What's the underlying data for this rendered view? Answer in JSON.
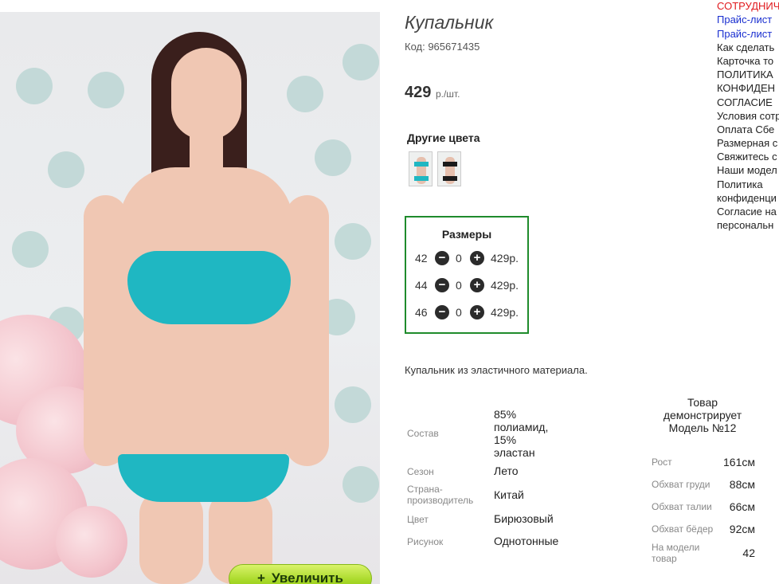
{
  "product": {
    "title": "Купальник",
    "code": "Код: 965671435",
    "price": "429",
    "price_unit": "р./шт.",
    "other_colors_title": "Другие цвета",
    "description": "Купальник из эластичного материала."
  },
  "photo": {
    "zoom_plus": "+",
    "zoom_label": "Увеличить"
  },
  "sizes": {
    "title": "Размеры",
    "rows": [
      {
        "size": "42",
        "qty": "0",
        "price": "429р."
      },
      {
        "size": "44",
        "qty": "0",
        "price": "429р."
      },
      {
        "size": "46",
        "qty": "0",
        "price": "429р."
      }
    ]
  },
  "specs": [
    {
      "label": "Состав",
      "value": "85% полиамид, 15% эластан"
    },
    {
      "label": "Сезон",
      "value": "Лето"
    },
    {
      "label": "Страна-производитель",
      "value": "Китай"
    },
    {
      "label": "Цвет",
      "value": "Бирюзовый"
    },
    {
      "label": "Рисунок",
      "value": "Однотонные"
    }
  ],
  "model": {
    "heading": "Товар демонстрирует Модель №12",
    "rows": [
      {
        "label": "Рост",
        "value": "161см"
      },
      {
        "label": "Обхват груди",
        "value": "88см"
      },
      {
        "label": "Обхват талии",
        "value": "66см"
      },
      {
        "label": "Обхват бёдер",
        "value": "92см"
      },
      {
        "label": "На модели товар",
        "value": "42"
      }
    ]
  },
  "menu": {
    "items": [
      {
        "label": "СОТРУДНИЧ",
        "color": "#e0191d"
      },
      {
        "label": "Прайс-лист ",
        "color": "#1a2fd0"
      },
      {
        "label": "Прайс-лист ",
        "color": "#1a2fd0"
      },
      {
        "label": "Как сделать",
        "color": "#222222"
      },
      {
        "label": "Карточка то",
        "color": "#222222"
      },
      {
        "label": "ПОЛИТИКА",
        "color": "#222222"
      },
      {
        "label": "КОНФИДЕН",
        "color": "#222222"
      },
      {
        "label": "СОГЛАСИЕ",
        "color": "#222222"
      },
      {
        "label": "Условия сотр",
        "color": "#222222"
      },
      {
        "label": "Оплата Сбе",
        "color": "#222222"
      },
      {
        "label": "Размерная с",
        "color": "#222222"
      },
      {
        "label": "Свяжитесь с",
        "color": "#222222"
      },
      {
        "label": "Наши модел",
        "color": "#222222"
      },
      {
        "label": "Политика",
        "color": "#222222"
      },
      {
        "label": "конфиденци",
        "color": "#222222"
      },
      {
        "label": "Согласие на",
        "color": "#222222"
      },
      {
        "label": "персональн",
        "color": "#222222"
      }
    ]
  },
  "colors": {
    "swimsuit": "#1fb7c2",
    "accent_green": "#1f8b2c",
    "zoom_button": "#a6d826"
  }
}
